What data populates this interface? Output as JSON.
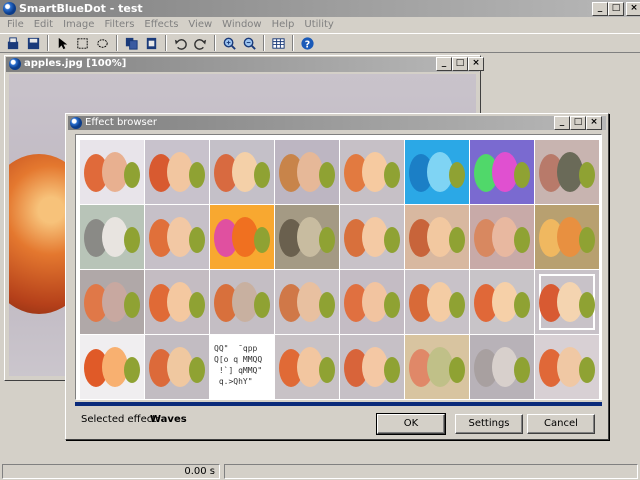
{
  "app": {
    "title": "SmartBlueDot - test",
    "window_buttons": [
      "_",
      "□",
      "×"
    ]
  },
  "menu": [
    "File",
    "Edit",
    "Image",
    "Filters",
    "Effects",
    "View",
    "Window",
    "Help",
    "Utility"
  ],
  "toolbar": {
    "tools": [
      "open-icon",
      "save-icon",
      "pointer-icon",
      "rect-select-icon",
      "lasso-icon",
      "copy-icon",
      "paste-icon",
      "undo-icon",
      "redo-icon",
      "zoom-in-icon",
      "zoom-out-icon",
      "grid-icon",
      "help-icon"
    ]
  },
  "document": {
    "title": "apples.jpg [100%]",
    "window_buttons": [
      "_",
      "□",
      "×"
    ]
  },
  "statusbar": {
    "time": "0.00 s"
  },
  "dialog": {
    "title": "Effect browser",
    "window_buttons": [
      "_",
      "□",
      "×"
    ],
    "selected_label": "Selected effect:",
    "selected_value": "Waves",
    "buttons": {
      "ok": "OK",
      "settings": "Settings",
      "cancel": "Cancel"
    },
    "ascii_text": "QQ\"  ̄ qpp\nQ[o q MMQQ\n !`] qMMQ\"\n q.>QhY\"",
    "thumbnails": [
      {
        "bg": "#e8e4ea",
        "a": "#e06a3a",
        "b": "#e8b090"
      },
      {
        "bg": "#c8c2cc",
        "a": "#d85a30",
        "b": "#f2c6a0"
      },
      {
        "bg": "#c4c0c8",
        "a": "#d86a40",
        "b": "#f4d0a8"
      },
      {
        "bg": "#bdb6c2",
        "a": "#c8844a",
        "b": "#e6b898"
      },
      {
        "bg": "#c6c0c6",
        "a": "#e27a40",
        "b": "#f6caa0"
      },
      {
        "bg": "#2ba8e6",
        "a": "#1b7fc6",
        "b": "#7fd4f4"
      },
      {
        "bg": "#7a6ad0",
        "a": "#50d86a",
        "b": "#e050d0"
      },
      {
        "bg": "#c8b4b0",
        "a": "#b87a6a",
        "b": "#6a6a58"
      },
      {
        "bg": "#b8c4b8",
        "a": "#8a8a86",
        "b": "#e8e4e0"
      },
      {
        "bg": "#c6c0c8",
        "a": "#e0703a",
        "b": "#f2c8a4"
      },
      {
        "bg": "#f8a830",
        "a": "#e050a0",
        "b": "#f07020"
      },
      {
        "bg": "#a49a84",
        "a": "#6a604e",
        "b": "#c8bca0"
      },
      {
        "bg": "#c8c2c8",
        "a": "#d8703c",
        "b": "#f4caa4"
      },
      {
        "bg": "#d8b8a0",
        "a": "#c8643a",
        "b": "#f2c8a0"
      },
      {
        "bg": "#c8aaa8",
        "a": "#d88860",
        "b": "#e8b8a0"
      },
      {
        "bg": "#b8a070",
        "a": "#f0b860",
        "b": "#e89040"
      },
      {
        "bg": "#b0a8a8",
        "a": "#e07848",
        "b": "#c8a8a0"
      },
      {
        "bg": "#c4bcc2",
        "a": "#e06a36",
        "b": "#f4c8a0"
      },
      {
        "bg": "#c4bec4",
        "a": "#d8703c",
        "b": "#c8b0a0"
      },
      {
        "bg": "#c8c2c8",
        "a": "#d07848",
        "b": "#e8c0a0"
      },
      {
        "bg": "#c4bcc4",
        "a": "#e07040",
        "b": "#f2c4a0"
      },
      {
        "bg": "#c8c2c8",
        "a": "#d86a38",
        "b": "#f4cca4"
      },
      {
        "bg": "#c8c4c8",
        "a": "#e06838",
        "b": "#f6d0a8"
      },
      {
        "bg": "#c8c2c8",
        "a": "#d85a32",
        "b": "#f4d4b0"
      },
      {
        "bg": "#f0eef0",
        "a": "#e05a28",
        "b": "#f8b070"
      },
      {
        "bg": "#c2bcc2",
        "a": "#dc6a3a",
        "b": "#f0c8a0"
      },
      {
        "bg": "#ffffff",
        "a": "#ffffff",
        "b": "#ffffff"
      },
      {
        "bg": "#c8c2c6",
        "a": "#e06a36",
        "b": "#f2c6a0"
      },
      {
        "bg": "#c6c0c6",
        "a": "#d8643a",
        "b": "#f4c8a4"
      },
      {
        "bg": "#d8c4a0",
        "a": "#e08868",
        "b": "#c0c088"
      },
      {
        "bg": "#b8b2b8",
        "a": "#a8a0a0",
        "b": "#d8d0cc"
      },
      {
        "bg": "#d8d0d4",
        "a": "#e06838",
        "b": "#f0c8a4"
      }
    ]
  }
}
